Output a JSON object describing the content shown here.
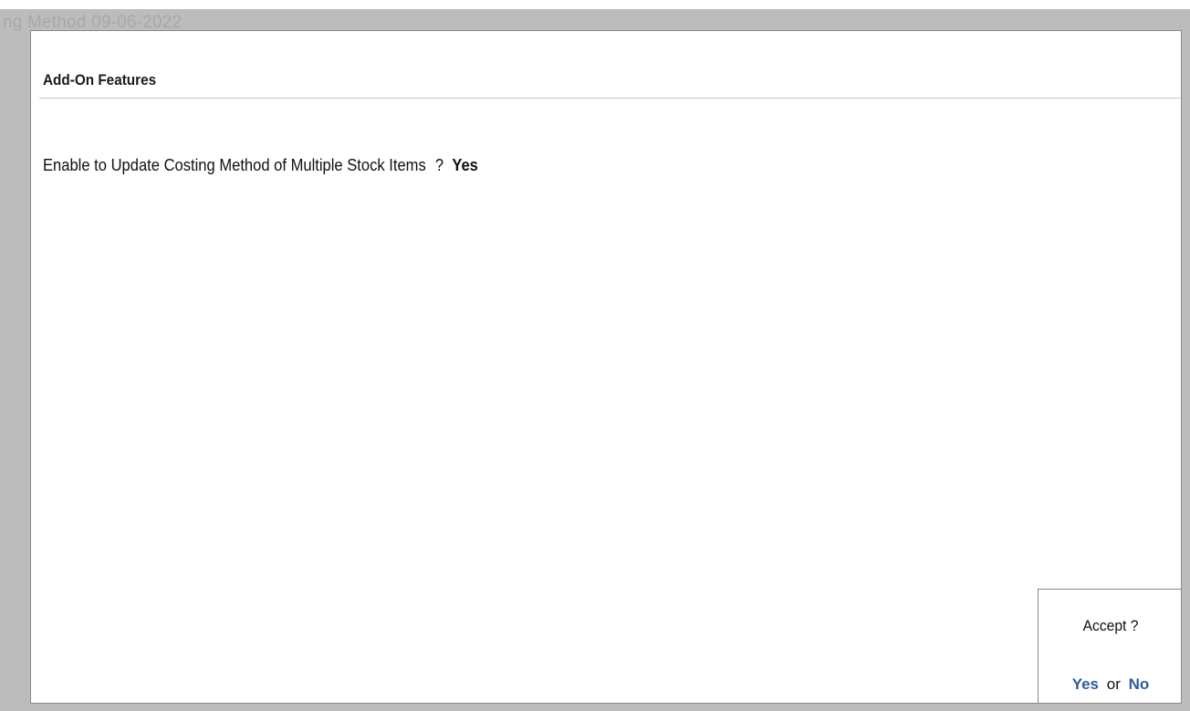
{
  "background": {
    "title_fragment": "ng Method 09-06-2022"
  },
  "panel": {
    "title": "Add-On Features",
    "field": {
      "label": "Enable to Update Costing Method of Multiple Stock Items",
      "separator": "?",
      "value": "Yes"
    }
  },
  "accept_dialog": {
    "prompt": "Accept ?",
    "yes_label": "Yes",
    "or_label": "or",
    "no_label": "No"
  },
  "colors": {
    "backdrop": "#bcbcbc",
    "option_accent": "#2a5d9b"
  }
}
